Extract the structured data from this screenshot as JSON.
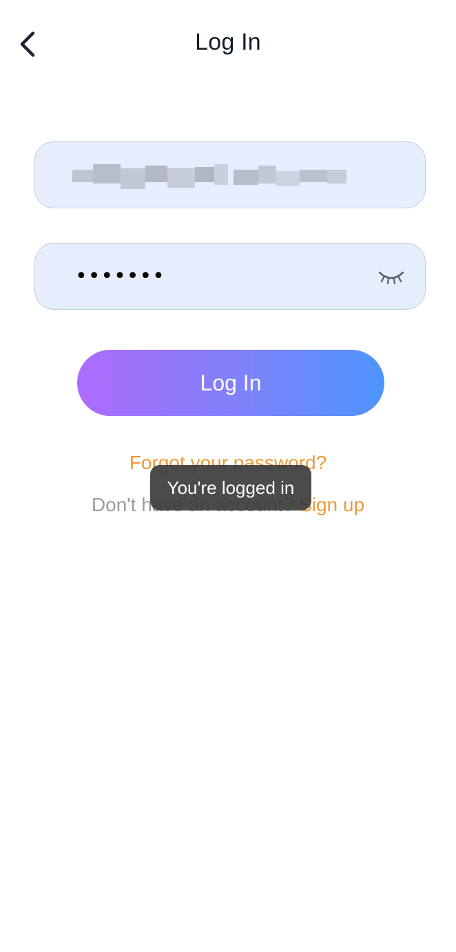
{
  "header": {
    "title": "Log In",
    "back_icon": "chevron-left-icon"
  },
  "form": {
    "email": {
      "value_redacted": true
    },
    "password": {
      "value": "•••••••",
      "visibility_icon": "eye-closed-icon"
    },
    "submit_label": "Log In"
  },
  "links": {
    "forgot_password": "Forgot your password?",
    "no_account_text": "Don't have an account?",
    "signup_label": "Sign up"
  },
  "toast": {
    "message": "You're logged in"
  },
  "colors": {
    "title": "#151b2b",
    "field_bg": "#e6eefd",
    "field_border": "#c7cbd5",
    "button_gradient_start": "#ad6bfd",
    "button_gradient_end": "#4d95fd",
    "link_orange": "#ec9a3a",
    "muted_text": "#9a9ca2",
    "toast_bg": "#3c3c3c"
  }
}
